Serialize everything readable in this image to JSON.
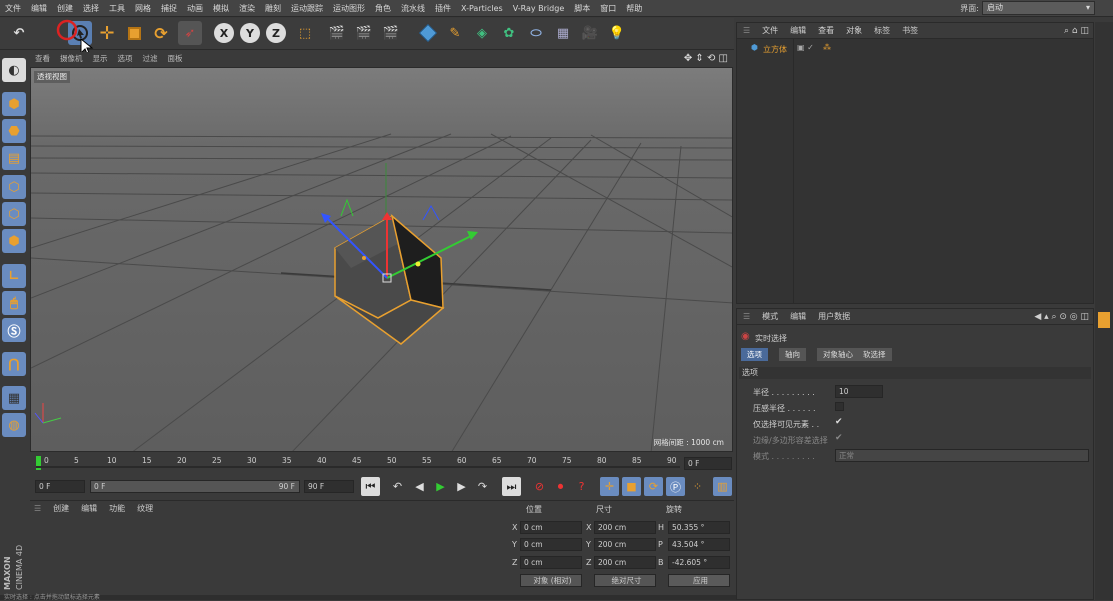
{
  "menubar": {
    "items": [
      "文件",
      "编辑",
      "创建",
      "选择",
      "工具",
      "网格",
      "捕捉",
      "动画",
      "模拟",
      "渲染",
      "雕刻",
      "运动跟踪",
      "运动图形",
      "角色",
      "流水线",
      "插件",
      "X-Particles",
      "V-Ray Bridge",
      "脚本",
      "窗口",
      "帮助"
    ],
    "layout_label": "界面:",
    "layout_value": "启动"
  },
  "viewport": {
    "menu": [
      "查看",
      "摄像机",
      "显示",
      "选项",
      "过滤",
      "面板"
    ],
    "view_name": "透视视图",
    "grid_info": "网格间距 : 1000 cm"
  },
  "timeline": {
    "ticks": [
      "0",
      "5",
      "10",
      "15",
      "20",
      "25",
      "30",
      "35",
      "40",
      "45",
      "50",
      "55",
      "60",
      "65",
      "70",
      "75",
      "80",
      "85",
      "90"
    ],
    "current_frame": "0 F"
  },
  "transport": {
    "start_frame": "0 F",
    "range_start": "0 F",
    "range_end": "90 F",
    "end_frame": "90 F"
  },
  "material": {
    "menu": [
      "创建",
      "编辑",
      "功能",
      "纹理"
    ]
  },
  "coords": {
    "headers": [
      "位置",
      "尺寸",
      "旋转"
    ],
    "rows": [
      {
        "axis": "X",
        "pos": "0 cm",
        "size_axis": "X",
        "size": "200 cm",
        "rot_axis": "H",
        "rot": "50.355 °"
      },
      {
        "axis": "Y",
        "pos": "0 cm",
        "size_axis": "Y",
        "size": "200 cm",
        "rot_axis": "P",
        "rot": "43.504 °"
      },
      {
        "axis": "Z",
        "pos": "0 cm",
        "size_axis": "Z",
        "size": "200 cm",
        "rot_axis": "B",
        "rot": "-42.605 °"
      }
    ],
    "mode": "对象 (相对)",
    "size_mode": "绝对尺寸",
    "apply": "应用"
  },
  "objects": {
    "menu": [
      "文件",
      "编辑",
      "查看",
      "对象",
      "标签",
      "书签"
    ],
    "items": [
      {
        "name": "立方体"
      }
    ]
  },
  "attributes": {
    "menu": [
      "模式",
      "编辑",
      "用户数据"
    ],
    "tool_name": "实时选择",
    "tabs": [
      "选项",
      "轴向",
      "对象轴心",
      "软选择"
    ],
    "section": "选项",
    "props": [
      {
        "label": "半径 . . . . . . . . .",
        "value": "10"
      },
      {
        "label": "压感半径 . . . . . .",
        "value": ""
      },
      {
        "label": "仅选择可见元素 . .",
        "value": "✔"
      },
      {
        "label": "边缘/多边形容差选择",
        "value": "✔"
      },
      {
        "label": "模式 . . . . . . . . .",
        "value": "正常"
      }
    ]
  },
  "brand": {
    "logo_text": "MAXON CINEMA 4D"
  },
  "status": {
    "text": "实时选择 : 点击并拖动鼠标选择元素"
  },
  "colors": {
    "accent": "#e8a030",
    "selection_blue": "#4a6a9a",
    "viewport_bg": "#6a6a6a"
  }
}
